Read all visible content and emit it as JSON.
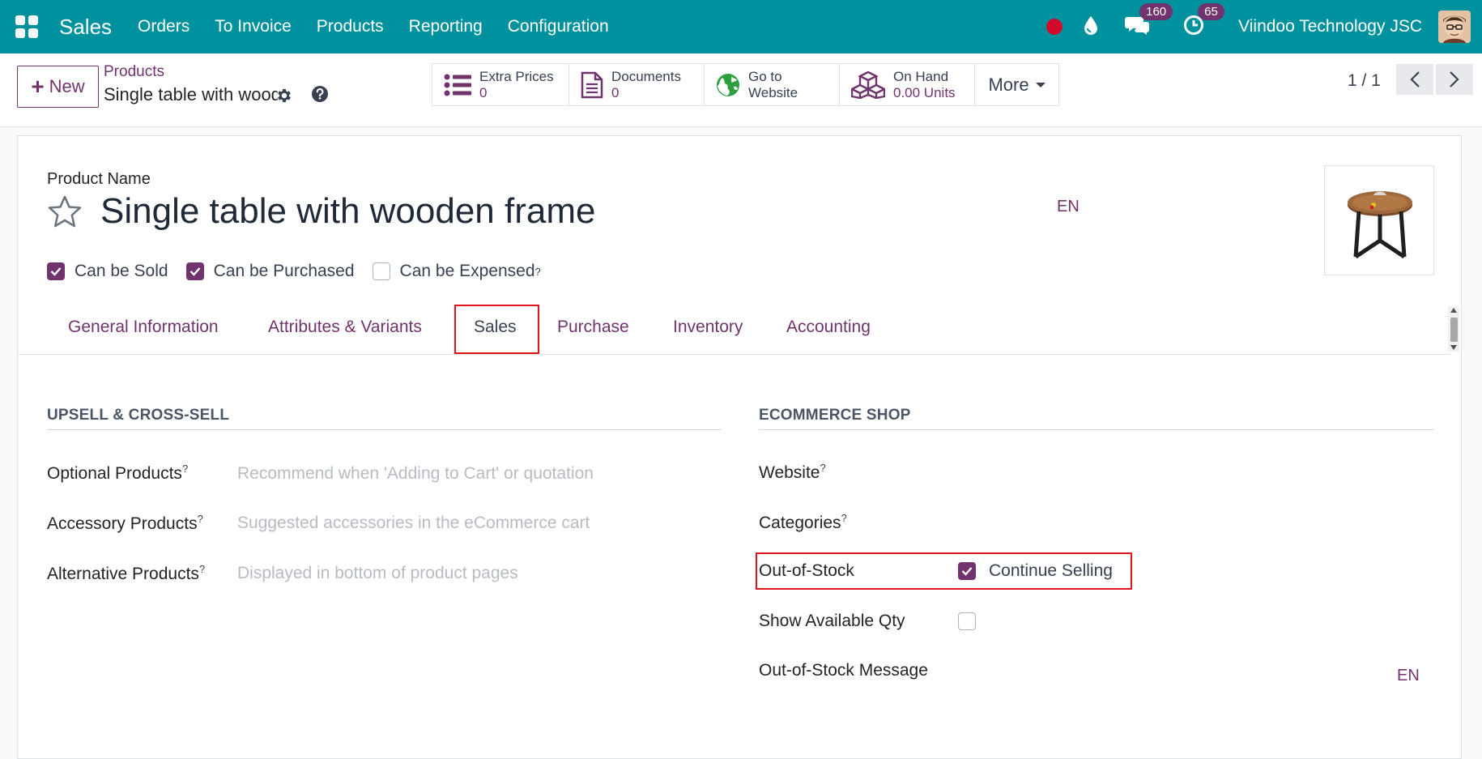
{
  "navbar": {
    "brand": "Sales",
    "menu": [
      "Orders",
      "To Invoice",
      "Products",
      "Reporting",
      "Configuration"
    ],
    "messages_badge": "160",
    "activities_badge": "65",
    "company": "Viindoo Technology JSC",
    "accent_color": "#00919e"
  },
  "control": {
    "new_label": "New",
    "breadcrumb_parent": "Products",
    "record_title": "Single table with wooden frame",
    "smart_buttons": {
      "extra_prices": {
        "label": "Extra Prices",
        "value": "0"
      },
      "documents": {
        "label": "Documents",
        "value": "0"
      },
      "website": {
        "label_line1": "Go to",
        "label_line2": "Website"
      },
      "on_hand": {
        "label": "On Hand",
        "value": "0.00 Units"
      },
      "more": "More"
    },
    "pager": "1 / 1"
  },
  "form": {
    "product_name_label": "Product Name",
    "product_name": "Single table with wooden frame",
    "lang": "EN",
    "checkboxes": {
      "can_be_sold": {
        "label": "Can be Sold",
        "checked": true
      },
      "can_be_purchased": {
        "label": "Can be Purchased",
        "checked": true
      },
      "can_be_expensed": {
        "label": "Can be Expensed",
        "checked": false
      }
    },
    "tooltip_mark": "?",
    "tabs": [
      "General Information",
      "Attributes & Variants",
      "Sales",
      "Purchase",
      "Inventory",
      "Accounting"
    ],
    "active_tab": "Sales",
    "upsell": {
      "title": "UPSELL & CROSS-SELL",
      "optional": {
        "label": "Optional Products",
        "placeholder": "Recommend when 'Adding to Cart' or quotation"
      },
      "accessory": {
        "label": "Accessory Products",
        "placeholder": "Suggested accessories in the eCommerce cart"
      },
      "alternative": {
        "label": "Alternative Products",
        "placeholder": "Displayed in bottom of product pages"
      }
    },
    "ecommerce": {
      "title": "ECOMMERCE SHOP",
      "website_label": "Website",
      "categories_label": "Categories",
      "out_of_stock_label": "Out-of-Stock",
      "continue_selling": {
        "label": "Continue Selling",
        "checked": true
      },
      "show_qty_label": "Show Available Qty",
      "show_qty_checked": false,
      "oos_message_label": "Out-of-Stock Message",
      "lang": "EN"
    },
    "brand_color": "#71336d",
    "highlight_color": "#e0131a"
  }
}
